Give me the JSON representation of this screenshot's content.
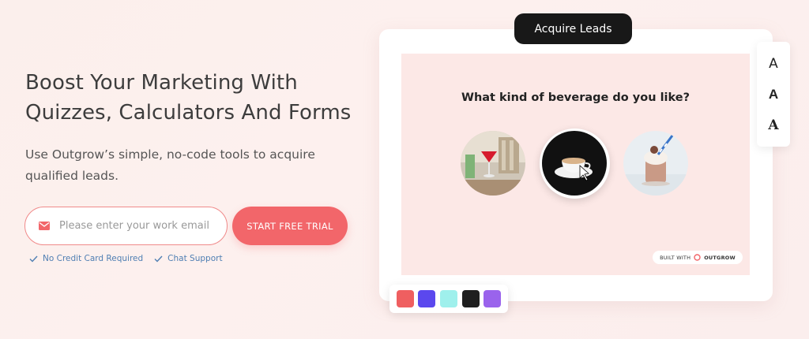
{
  "hero": {
    "title": "Boost Your Marketing With Quizzes, Calculators And Forms",
    "subtitle": "Use Outgrow’s simple, no-code tools to acquire qualified leads."
  },
  "signup": {
    "email_placeholder": "Please enter your work email",
    "cta_label": "START FREE TRIAL",
    "features": [
      "No Credit Card Required",
      "Chat Support"
    ]
  },
  "preview": {
    "pill_label": "Acquire Leads",
    "question": "What kind of beverage do you like?",
    "options": [
      "cocktail-image",
      "coffee-image",
      "milkshake-image"
    ],
    "selected_option": 1,
    "built_with_prefix": "BUILT WITH",
    "built_with_brand": "OUTGROW",
    "font_options": [
      "A",
      "A",
      "A"
    ],
    "palette": [
      "#ef5f60",
      "#5b48ee",
      "#9ff0ec",
      "#1f1f1f",
      "#9a63ec"
    ]
  },
  "colors": {
    "accent": "#f2666a",
    "feature_text": "#4f7fb3",
    "pill_bg": "#181818"
  }
}
